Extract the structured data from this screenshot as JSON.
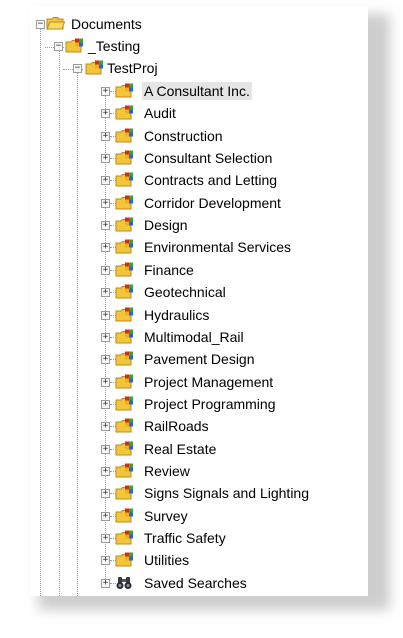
{
  "tree": {
    "root": {
      "label": "Documents",
      "expander": "−",
      "icon": "open-folder-icon"
    },
    "testing": {
      "label": "_Testing",
      "expander": "−",
      "icon": "project-folder-icon"
    },
    "testproj": {
      "label": "TestProj",
      "expander": "−",
      "icon": "project-folder-icon"
    },
    "children": [
      {
        "label": "A Consultant Inc.",
        "expander": "+",
        "icon": "project-folder-icon",
        "selected": true
      },
      {
        "label": "Audit",
        "expander": "+",
        "icon": "project-folder-icon"
      },
      {
        "label": "Construction",
        "expander": "+",
        "icon": "project-folder-icon"
      },
      {
        "label": "Consultant Selection",
        "expander": "+",
        "icon": "project-folder-icon"
      },
      {
        "label": "Contracts and Letting",
        "expander": "+",
        "icon": "project-folder-icon"
      },
      {
        "label": "Corridor Development",
        "expander": "+",
        "icon": "project-folder-icon"
      },
      {
        "label": "Design",
        "expander": "+",
        "icon": "project-folder-icon"
      },
      {
        "label": "Environmental Services",
        "expander": "+",
        "icon": "project-folder-icon"
      },
      {
        "label": "Finance",
        "expander": "+",
        "icon": "project-folder-icon"
      },
      {
        "label": "Geotechnical",
        "expander": "+",
        "icon": "project-folder-icon"
      },
      {
        "label": "Hydraulics",
        "expander": "+",
        "icon": "project-folder-icon"
      },
      {
        "label": "Multimodal_Rail",
        "expander": "+",
        "icon": "project-folder-icon"
      },
      {
        "label": "Pavement Design",
        "expander": "+",
        "icon": "project-folder-icon"
      },
      {
        "label": "Project Management",
        "expander": "+",
        "icon": "project-folder-icon"
      },
      {
        "label": "Project Programming",
        "expander": "+",
        "icon": "project-folder-icon"
      },
      {
        "label": "RailRoads",
        "expander": "+",
        "icon": "project-folder-icon"
      },
      {
        "label": "Real Estate",
        "expander": "+",
        "icon": "project-folder-icon"
      },
      {
        "label": "Review",
        "expander": "+",
        "icon": "project-folder-icon"
      },
      {
        "label": "Signs Signals and Lighting",
        "expander": "+",
        "icon": "project-folder-icon"
      },
      {
        "label": "Survey",
        "expander": "+",
        "icon": "project-folder-icon"
      },
      {
        "label": "Traffic Safety",
        "expander": "+",
        "icon": "project-folder-icon"
      },
      {
        "label": "Utilities",
        "expander": "+",
        "icon": "project-folder-icon"
      },
      {
        "label": "Saved Searches",
        "expander": "+",
        "icon": "binoculars-icon"
      }
    ]
  },
  "colors": {
    "folder_yellow": "#f2c53a",
    "folder_outline": "#b98a1e",
    "badge_red": "#d9281c",
    "badge_green": "#3aa535",
    "badge_blue": "#2f62d6",
    "selection_bg": "#e5e5e5"
  }
}
